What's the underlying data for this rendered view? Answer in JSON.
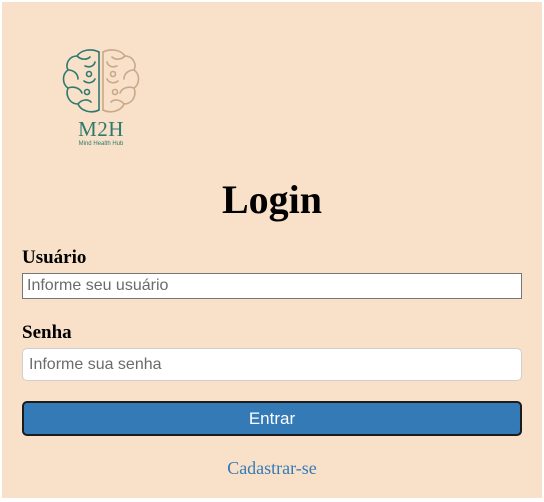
{
  "logo": {
    "title": "M2H",
    "subtitle": "Mind Health Hub",
    "icon": "brain-icon",
    "colors": {
      "left": "#2e7a6e",
      "right": "#c9a88a"
    }
  },
  "form": {
    "title": "Login",
    "username_label": "Usuário",
    "username_placeholder": "Informe seu usuário",
    "password_label": "Senha",
    "password_placeholder": "Informe sua senha",
    "submit_label": "Entrar",
    "signup_link": "Cadastrar-se"
  },
  "colors": {
    "background": "#f8e1c8",
    "accent": "#337ab7"
  }
}
